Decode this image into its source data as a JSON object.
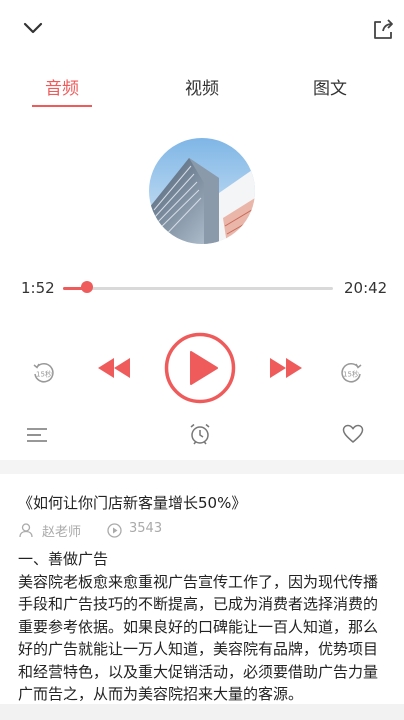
{
  "header": {
    "collapse_icon": "chevron-down-icon",
    "share_icon": "share-icon"
  },
  "tabs": [
    {
      "label": "音频",
      "active": true
    },
    {
      "label": "视频",
      "active": false
    },
    {
      "label": "图文",
      "active": false
    }
  ],
  "player": {
    "current_time": "1:52",
    "total_time": "20:42",
    "progress": 0.09,
    "rewind_label": "15秒",
    "forward_label": "15秒",
    "accent_color": "#ef5b5b"
  },
  "actions": {
    "playlist_icon": "list-icon",
    "timer_icon": "alarm-clock-icon",
    "favorite_icon": "heart-icon"
  },
  "article": {
    "title": "《如何让你门店新客量增长50%》",
    "author": "赵老师",
    "plays": "3543",
    "section": "一、善做广告",
    "body": "美容院老板愈来愈重视广告宣传工作了，因为现代传播手段和广告技巧的不断提高，已成为消费者选择消费的重要参考依据。如果良好的口碑能让一百人知道，那么好的广告就能让一万人知道，美容院有品牌，优势项目和经营特色，以及重大促销活动，必须要借助广告力量广而告之，从而为美容院招来大量的客源。"
  }
}
